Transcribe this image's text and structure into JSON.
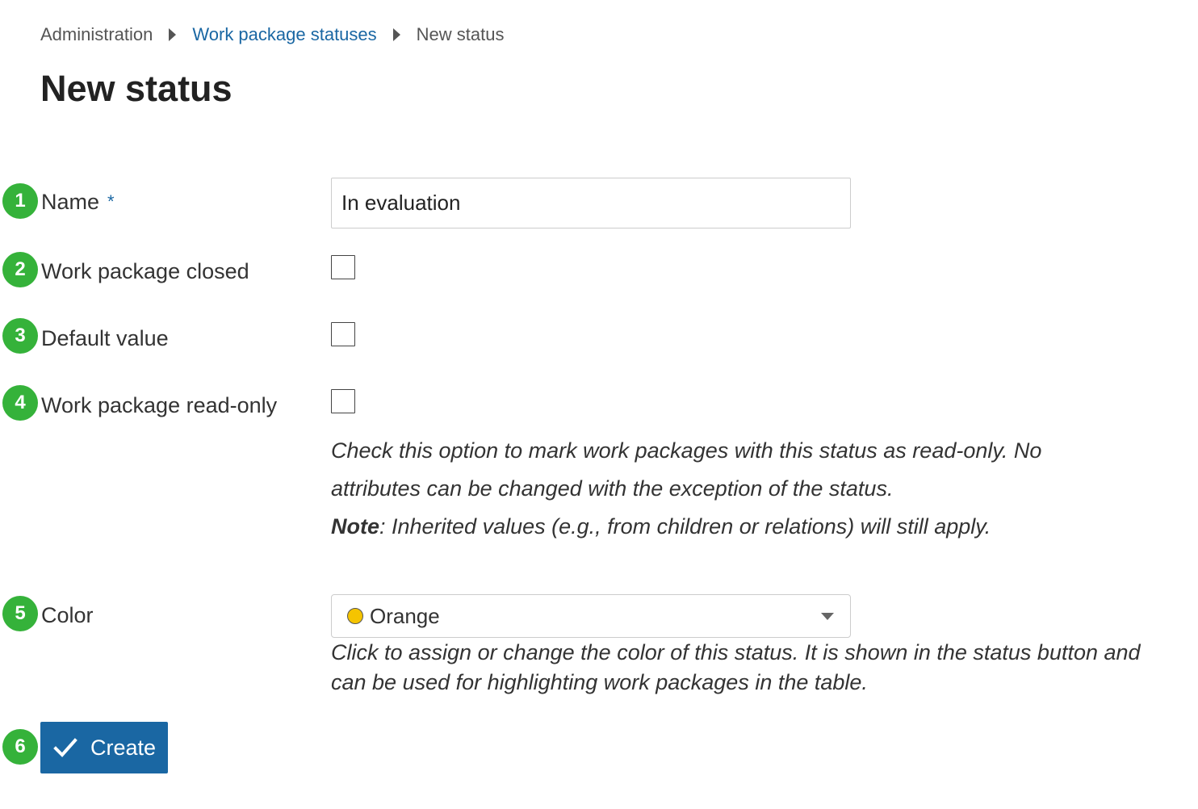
{
  "breadcrumb": {
    "items": [
      {
        "label": "Administration"
      },
      {
        "label": "Work package statuses"
      },
      {
        "label": "New status"
      }
    ]
  },
  "page": {
    "title": "New status"
  },
  "badges": [
    "1",
    "2",
    "3",
    "4",
    "5",
    "6"
  ],
  "form": {
    "name": {
      "label": "Name",
      "required_mark": "*",
      "value": "In evaluation"
    },
    "closed": {
      "label": "Work package closed",
      "checked": false
    },
    "default_value": {
      "label": "Default value",
      "checked": false
    },
    "read_only": {
      "label": "Work package read-only",
      "checked": false,
      "help_line1": "Check this option to mark work packages with this status as read-only. No",
      "help_line2": "attributes can be changed with the exception of the status.",
      "help_note_label": "Note",
      "help_note_text": ": Inherited values (e.g., from children or relations) will still apply."
    },
    "color": {
      "label": "Color",
      "selected": "Orange",
      "swatch": "#f5c400",
      "help_line1": "Click to assign or change the color of this status. It is shown in the status button and",
      "help_line2": "can be used for highlighting work packages in the table."
    }
  },
  "actions": {
    "create_label": "Create",
    "create_icon": "checkmark-icon"
  },
  "colors": {
    "accent": "#1a67a3",
    "badge": "#35b23a"
  }
}
